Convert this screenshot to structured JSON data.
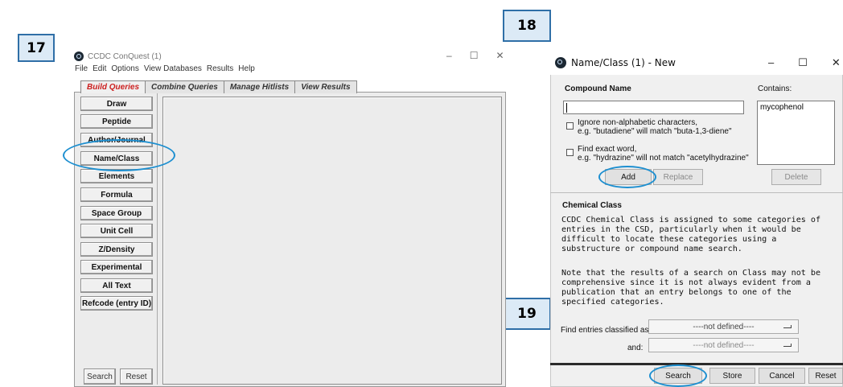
{
  "badges": {
    "b17": "17",
    "b18": "18",
    "b19": "19"
  },
  "conquest": {
    "title": "CCDC ConQuest (1)",
    "window_controls": {
      "minimize": "–",
      "maximize": "☐",
      "close": "✕"
    },
    "menu": [
      "File",
      "Edit",
      "Options",
      "View Databases",
      "Results",
      "Help"
    ],
    "tabs": [
      "Build Queries",
      "Combine Queries",
      "Manage Hitlists",
      "View Results"
    ],
    "query_buttons": [
      "Draw",
      "Peptide",
      "Author/Journal",
      "Name/Class",
      "Elements",
      "Formula",
      "Space Group",
      "Unit Cell",
      "Z/Density",
      "Experimental",
      "All Text",
      "Refcode (entry ID)"
    ],
    "search_label": "Search",
    "reset_label": "Reset"
  },
  "dialog": {
    "title": "Name/Class (1) - New",
    "window_controls": {
      "minimize": "–",
      "maximize": "☐",
      "close": "✕"
    },
    "compound_name_label": "Compound Name",
    "contains_label": "Contains:",
    "name_input_value": "",
    "contains_items": [
      "mycophenol"
    ],
    "ignore_label_1": "Ignore non-alphabetic characters,",
    "ignore_label_2": "e.g. \"butadiene\" will match \"buta-1,3-diene\"",
    "exact_label_1": "Find exact word,",
    "exact_label_2": "e.g. \"hydrazine\" will not match \"acetylhydrazine\"",
    "add_label": "Add",
    "replace_label": "Replace",
    "delete_label": "Delete",
    "chem_class_label": "Chemical Class",
    "desc_lines": [
      "CCDC Chemical Class is assigned to some categories of",
      "entries in the CSD, particularly when it would be",
      "difficult to locate these categories using a",
      "substructure or compound name search.",
      "",
      "Note that the results of a search on Class may not be",
      "comprehensive since it is not always evident from a",
      "publication that an entry belongs to one of the",
      "specified categories."
    ],
    "find_classified_label": "Find entries classified as:",
    "and_label": "and:",
    "class_1": "----not defined----",
    "class_2": "----not defined----",
    "search_label": "Search",
    "store_label": "Store",
    "cancel_label": "Cancel",
    "reset_label": "Reset"
  }
}
